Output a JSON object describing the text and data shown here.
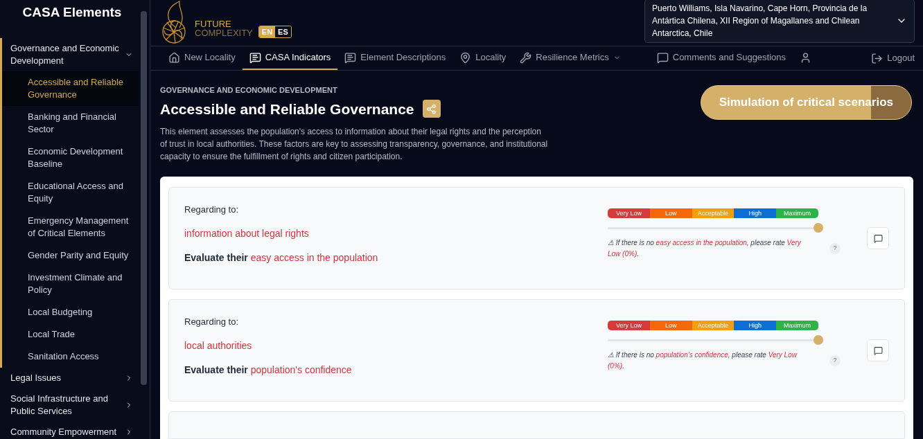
{
  "sidebar": {
    "title": "CASA Elements",
    "groups": [
      {
        "label": "Governance and Economic Development",
        "expanded": true,
        "children": [
          {
            "label": "Accessible and Reliable Governance",
            "selected": true
          },
          {
            "label": "Banking and Financial Sector",
            "selected": false
          },
          {
            "label": "Economic Development Baseline",
            "selected": false
          },
          {
            "label": "Educational Access and Equity",
            "selected": false
          },
          {
            "label": "Emergency Management of Critical Elements",
            "selected": false
          },
          {
            "label": "Gender Parity and Equity",
            "selected": false
          },
          {
            "label": "Investment Climate and Policy",
            "selected": false
          },
          {
            "label": "Local Budgeting",
            "selected": false
          },
          {
            "label": "Local Trade",
            "selected": false
          },
          {
            "label": "Sanitation Access",
            "selected": false
          }
        ]
      },
      {
        "label": "Legal Issues",
        "expanded": false
      },
      {
        "label": "Social Infrastructure and Public Services",
        "expanded": false
      },
      {
        "label": "Community Empowerment",
        "expanded": false
      }
    ]
  },
  "header": {
    "logo_line1": "FUTURE",
    "logo_line2": "COMPLEXITY",
    "languages": [
      {
        "label": "EN",
        "selected": true
      },
      {
        "label": "ES",
        "selected": false
      }
    ],
    "location": "Puerto Williams, Isla Navarino, Cape Horn, Provincia de la Antártica Chilena, XII Region of Magallanes and Chilean Antarctica, Chile"
  },
  "nav": [
    {
      "kind": "home",
      "label": "New Locality",
      "selected": false
    },
    {
      "kind": "chat-question",
      "label": "CASA Indicators",
      "selected": true
    },
    {
      "kind": "chat-question",
      "label": "Element Descriptions",
      "selected": false
    },
    {
      "kind": "pin",
      "label": "Locality",
      "selected": false
    },
    {
      "kind": "wrench",
      "label": "Resilience Metrics",
      "selected": false,
      "dropdown": true
    },
    {
      "kind": "chat",
      "label": "Comments and Suggestions",
      "selected": false
    },
    {
      "kind": "user",
      "selected": false
    }
  ],
  "logout": "Logout",
  "element": {
    "category": "GOVERNANCE AND ECONOMIC DEVELOPMENT",
    "title": "Accessible and Reliable Governance",
    "description": "This element assesses the population's access to information about their legal rights and the perception of trust in local authorities. These factors are key to assessing transparency, governance, and institutional capacity to ensure the fulfillment of rights and citizen participation.",
    "simulation_button": "Simulation of critical scenarios"
  },
  "indicators": [
    {
      "scale": [
        {
          "label": "Very Low",
          "color": "#d63a3a"
        },
        {
          "label": "Low",
          "color": "#f4680b"
        },
        {
          "label": "Acceptable",
          "color": "#f59e0b"
        },
        {
          "label": "High",
          "color": "#0b6fd6"
        },
        {
          "label": "Maximum",
          "color": "#2db34a"
        }
      ],
      "regarding_label": "Regarding to:",
      "subject": "information about legal rights",
      "evaluate_prefix": "Evaluate their",
      "evaluate_target": "easy access in the population",
      "level": 1,
      "help": "?",
      "note": [
        {
          "text": "⚠ If there is no ",
          "highlight": false
        },
        {
          "text": "easy access in the population",
          "highlight": true
        },
        {
          "text": ", please rate ",
          "highlight": false
        },
        {
          "text": "Very Low (0%)",
          "highlight": true
        },
        {
          "text": ".",
          "highlight": false
        }
      ]
    },
    {
      "scale": [
        {
          "label": "Very Low",
          "color": "#d63a3a"
        },
        {
          "label": "Low",
          "color": "#f4680b"
        },
        {
          "label": "Acceptable",
          "color": "#f59e0b"
        },
        {
          "label": "High",
          "color": "#0b6fd6"
        },
        {
          "label": "Maximum",
          "color": "#2db34a"
        }
      ],
      "regarding_label": "Regarding to:",
      "subject": "local authorities",
      "evaluate_prefix": "Evaluate their",
      "evaluate_target": "population's confidence",
      "level": 1,
      "help": "?",
      "note": [
        {
          "text": "⚠ If there is no ",
          "highlight": false
        },
        {
          "text": "population's confidence",
          "highlight": true
        },
        {
          "text": ", please rate ",
          "highlight": false
        },
        {
          "text": "Very Low (0%)",
          "highlight": true
        },
        {
          "text": ".",
          "highlight": false
        }
      ]
    }
  ]
}
